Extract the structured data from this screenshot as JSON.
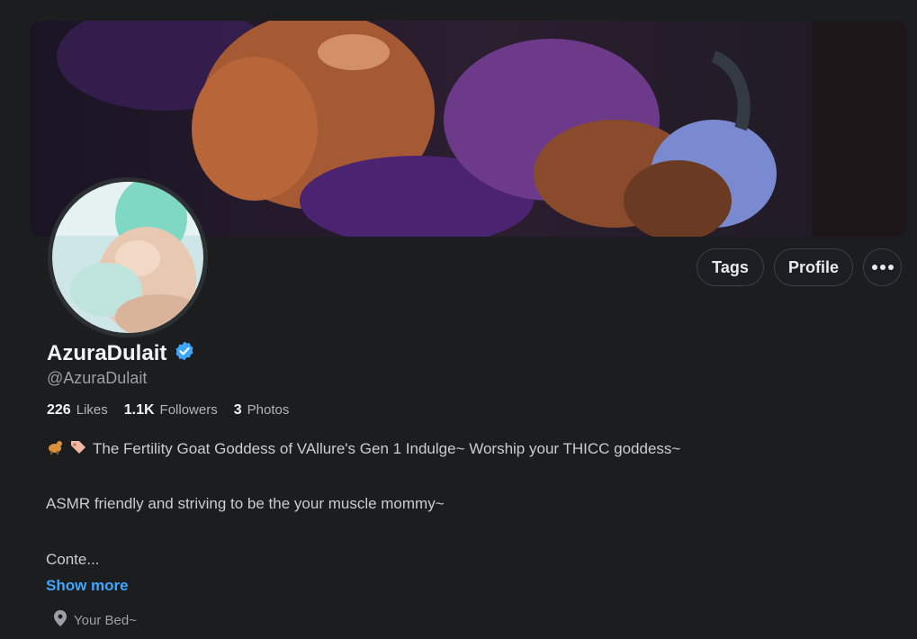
{
  "profile": {
    "display_name": "AzuraDulait",
    "handle": "@AzuraDulait",
    "verified_icon": "verified-badge-icon",
    "accent_color": "#3ea6ff"
  },
  "actions": {
    "tags_label": "Tags",
    "profile_label": "Profile",
    "more_icon": "more-dots-icon"
  },
  "stats": [
    {
      "value": "226",
      "label": "Likes"
    },
    {
      "value": "1.1K",
      "label": "Followers"
    },
    {
      "value": "3",
      "label": "Photos"
    }
  ],
  "bio": {
    "line1_icons": [
      "goat-icon",
      "tag-icon"
    ],
    "line1": "The Fertility Goat Goddess of VAllure's Gen 1 Indulge~ Worship your THICC goddess~",
    "line2": "ASMR friendly and striving to be the your muscle mommy~",
    "line3": "Conte...",
    "show_more": "Show more"
  },
  "location": {
    "icon": "location-pin-icon",
    "text": "Your Bed~"
  }
}
